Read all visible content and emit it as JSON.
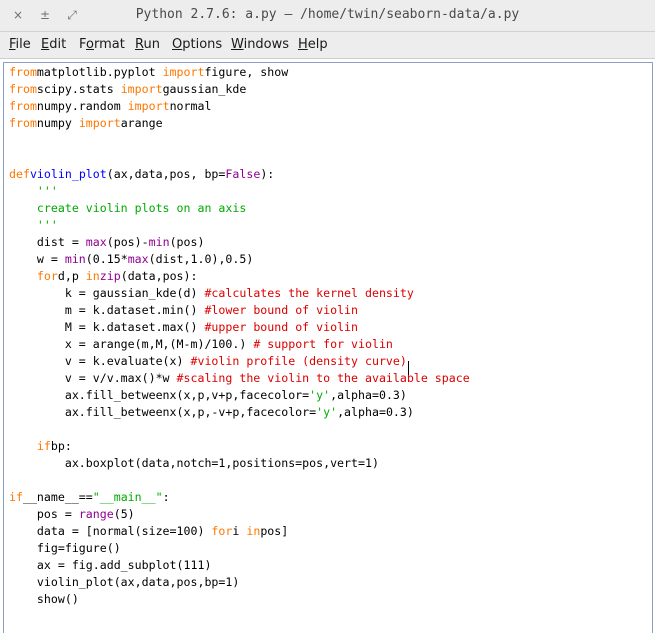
{
  "window": {
    "title": "Python 2.7.6: a.py — /home/twin/seaborn-data/a.py",
    "controls": {
      "close": "×",
      "minimize": "±",
      "maximize": "⤢"
    }
  },
  "menubar": {
    "items": [
      {
        "u": "F",
        "rest": "ile"
      },
      {
        "u": "E",
        "rest": "dit"
      },
      {
        "pre": "F",
        "u": "o",
        "rest": "rmat"
      },
      {
        "u": "R",
        "rest": "un"
      },
      {
        "u": "O",
        "rest": "ptions"
      },
      {
        "u": "W",
        "rest": "indows"
      },
      {
        "u": "H",
        "rest": "elp"
      }
    ]
  },
  "editor": {
    "colors": {
      "keyword": "#ff7700",
      "builtin": "#900090",
      "string": "#00aa00",
      "comment": "#dd0000",
      "definition": "#0000ff"
    },
    "lines": [
      [
        [
          "kw",
          "from"
        ],
        [
          "",
          "matplotlib.pyplot "
        ],
        [
          "kw",
          "import"
        ],
        [
          "",
          "figure, show"
        ]
      ],
      [
        [
          "kw",
          "from"
        ],
        [
          "",
          "scipy.stats "
        ],
        [
          "kw",
          "import"
        ],
        [
          "",
          "gaussian_kde"
        ]
      ],
      [
        [
          "kw",
          "from"
        ],
        [
          "",
          "numpy.random "
        ],
        [
          "kw",
          "import"
        ],
        [
          "",
          "normal"
        ]
      ],
      [
        [
          "kw",
          "from"
        ],
        [
          "",
          "numpy "
        ],
        [
          "kw",
          "import"
        ],
        [
          "",
          "arange"
        ]
      ],
      [],
      [],
      [
        [
          "kw",
          "def"
        ],
        [
          "df",
          "violin_plot"
        ],
        [
          "",
          "(ax,data,pos, bp="
        ],
        [
          "bi",
          "False"
        ],
        [
          "",
          "):"
        ]
      ],
      [
        [
          "",
          "    "
        ],
        [
          "str",
          "'''"
        ]
      ],
      [
        [
          "",
          "    "
        ],
        [
          "str",
          "create violin plots on an axis"
        ]
      ],
      [
        [
          "",
          "    "
        ],
        [
          "str",
          "'''"
        ]
      ],
      [
        [
          "",
          "    dist = "
        ],
        [
          "bi",
          "max"
        ],
        [
          "",
          "(pos)-"
        ],
        [
          "bi",
          "min"
        ],
        [
          "",
          "(pos)"
        ]
      ],
      [
        [
          "",
          "    w = "
        ],
        [
          "bi",
          "min"
        ],
        [
          "",
          "(0.15*"
        ],
        [
          "bi",
          "max"
        ],
        [
          "",
          "(dist,1.0),0.5)"
        ]
      ],
      [
        [
          "",
          "    "
        ],
        [
          "kw",
          "for"
        ],
        [
          "",
          "d,p "
        ],
        [
          "kw",
          "in"
        ],
        [
          "bi",
          "zip"
        ],
        [
          "",
          "(data,pos):"
        ]
      ],
      [
        [
          "",
          "        k = gaussian_kde(d) "
        ],
        [
          "cm",
          "#calculates the kernel density"
        ]
      ],
      [
        [
          "",
          "        m = k.dataset.min() "
        ],
        [
          "cm",
          "#lower bound of violin"
        ]
      ],
      [
        [
          "",
          "        M = k.dataset.max() "
        ],
        [
          "cm",
          "#upper bound of violin"
        ]
      ],
      [
        [
          "",
          "        x = arange(m,M,(M-m)/100.) "
        ],
        [
          "cm",
          "# support for violin"
        ]
      ],
      [
        [
          "",
          "        v = k.evaluate(x) "
        ],
        [
          "cm",
          "#violin profile (density curve)"
        ]
      ],
      [
        [
          "",
          "        v = v/v.max()*w "
        ],
        [
          "cm",
          "#scaling the violin to the available space"
        ]
      ],
      [
        [
          "",
          "        ax.fill_betweenx(x,p,v+p,facecolor="
        ],
        [
          "str",
          "'y'"
        ],
        [
          "",
          ",alpha=0.3)"
        ]
      ],
      [
        [
          "",
          "        ax.fill_betweenx(x,p,-v+p,facecolor="
        ],
        [
          "str",
          "'y'"
        ],
        [
          "",
          ",alpha=0.3)"
        ]
      ],
      [],
      [
        [
          "",
          "    "
        ],
        [
          "kw",
          "if"
        ],
        [
          "",
          "bp:"
        ]
      ],
      [
        [
          "",
          "        ax.boxplot(data,notch=1,positions=pos,vert=1)"
        ]
      ],
      [],
      [
        [
          "kw",
          "if"
        ],
        [
          "",
          "__name__=="
        ],
        [
          "str",
          "\"__main__\""
        ],
        [
          "",
          ":"
        ]
      ],
      [
        [
          "",
          "    pos = "
        ],
        [
          "bi",
          "range"
        ],
        [
          "",
          "(5)"
        ]
      ],
      [
        [
          "",
          "    data = [normal(size=100) "
        ],
        [
          "kw",
          "for"
        ],
        [
          "",
          "i "
        ],
        [
          "kw",
          "in"
        ],
        [
          "",
          "pos]"
        ]
      ],
      [
        [
          "",
          "    fig=figure()"
        ]
      ],
      [
        [
          "",
          "    ax = fig.add_subplot(111)"
        ]
      ],
      [
        [
          "",
          "    violin_plot(ax,data,pos,bp=1)"
        ]
      ],
      [
        [
          "",
          "    show()"
        ]
      ]
    ]
  }
}
